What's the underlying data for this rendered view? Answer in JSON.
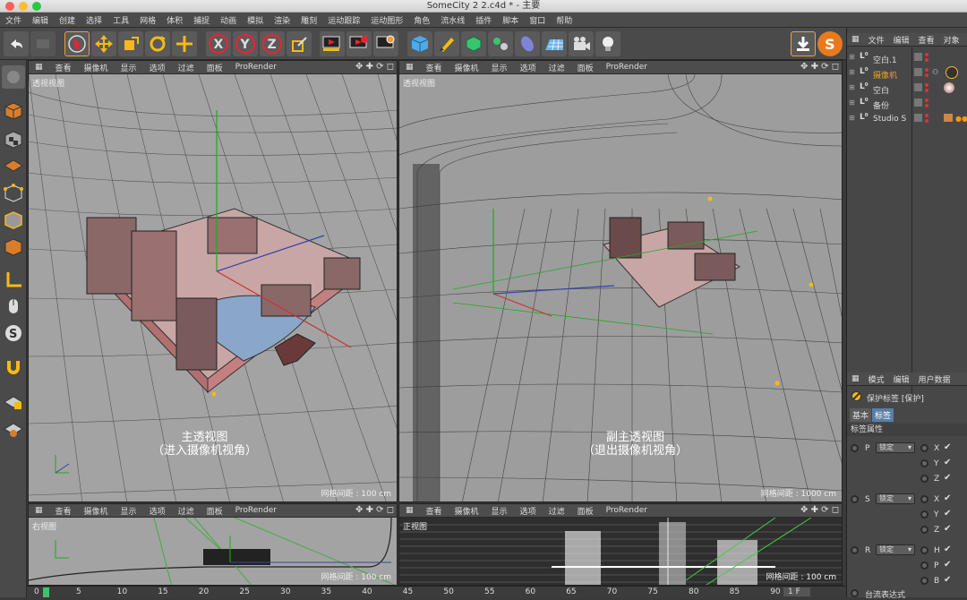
{
  "window": {
    "title": "SomeCity 2 2.c4d * - 主要"
  },
  "menubar": [
    "文件",
    "编辑",
    "创建",
    "选择",
    "工具",
    "网格",
    "体积",
    "捕捉",
    "动画",
    "模拟",
    "渲染",
    "雕刻",
    "运动跟踪",
    "运动图形",
    "角色",
    "流水线",
    "插件",
    "脚本",
    "窗口",
    "帮助"
  ],
  "toolbar_icons": [
    "undo-icon",
    "redo-icon",
    "select-icon",
    "move-icon",
    "scale-icon",
    "rotate-icon",
    "transform-icon",
    "x-axis-icon",
    "y-axis-icon",
    "z-axis-icon",
    "coordinate-icon",
    "render-view-icon",
    "render-picture-queue-icon",
    "render-settings-icon",
    "cube-icon",
    "pen-icon",
    "subdivision-icon",
    "array-icon",
    "deformer-icon",
    "floor-icon",
    "camera-icon",
    "light-icon"
  ],
  "viewport_menu": [
    "查看",
    "摄像机",
    "显示",
    "选项",
    "过滤",
    "面板",
    "ProRender"
  ],
  "viewports": {
    "main": {
      "label": "透视视图",
      "grid": "网格间距 : 100 cm",
      "caption": [
        "主透视图",
        "（进入摄像机视角）"
      ]
    },
    "secondary": {
      "label": "透视视图",
      "grid": "网格间距 : 1000 cm",
      "caption": [
        "副主透视图",
        "（退出摄像机视角）"
      ]
    },
    "right": {
      "label": "右视图",
      "grid": "网格间距 : 100 cm"
    },
    "front": {
      "label": "正视图",
      "grid": "网格间距 : 100 cm"
    }
  },
  "object_manager": {
    "menu": [
      "文件",
      "编辑",
      "查看",
      "对象"
    ],
    "objects": [
      {
        "name": "空白.1",
        "color": "#dddddd"
      },
      {
        "name": "摄像机",
        "color": "#f0a030"
      },
      {
        "name": "空白",
        "color": "#dddddd"
      },
      {
        "name": "备份",
        "color": "#dddddd"
      },
      {
        "name": "Studio S",
        "color": "#dddddd"
      }
    ]
  },
  "attributes": {
    "menu": [
      "模式",
      "编辑",
      "用户数据"
    ],
    "tag_title": "保护标签 [保护]",
    "tabs": [
      "基本",
      "标签"
    ],
    "section": "标签属性",
    "rows": [
      {
        "label": "P",
        "value": "锁定",
        "axes": [
          "X",
          "Y",
          "Z"
        ]
      },
      {
        "label": "S",
        "value": "锁定",
        "axes": [
          "X",
          "Y",
          "Z"
        ]
      },
      {
        "label": "R",
        "value": "锁定",
        "axes": [
          "H",
          "P",
          "B"
        ]
      }
    ],
    "bottom": "台流表达式"
  },
  "timeline": {
    "current": "0",
    "ticks": [
      "5",
      "10",
      "15",
      "20",
      "25",
      "30",
      "35",
      "40",
      "45",
      "50",
      "55",
      "60",
      "65",
      "70",
      "75",
      "80",
      "85",
      "90"
    ],
    "field": "1 F"
  }
}
